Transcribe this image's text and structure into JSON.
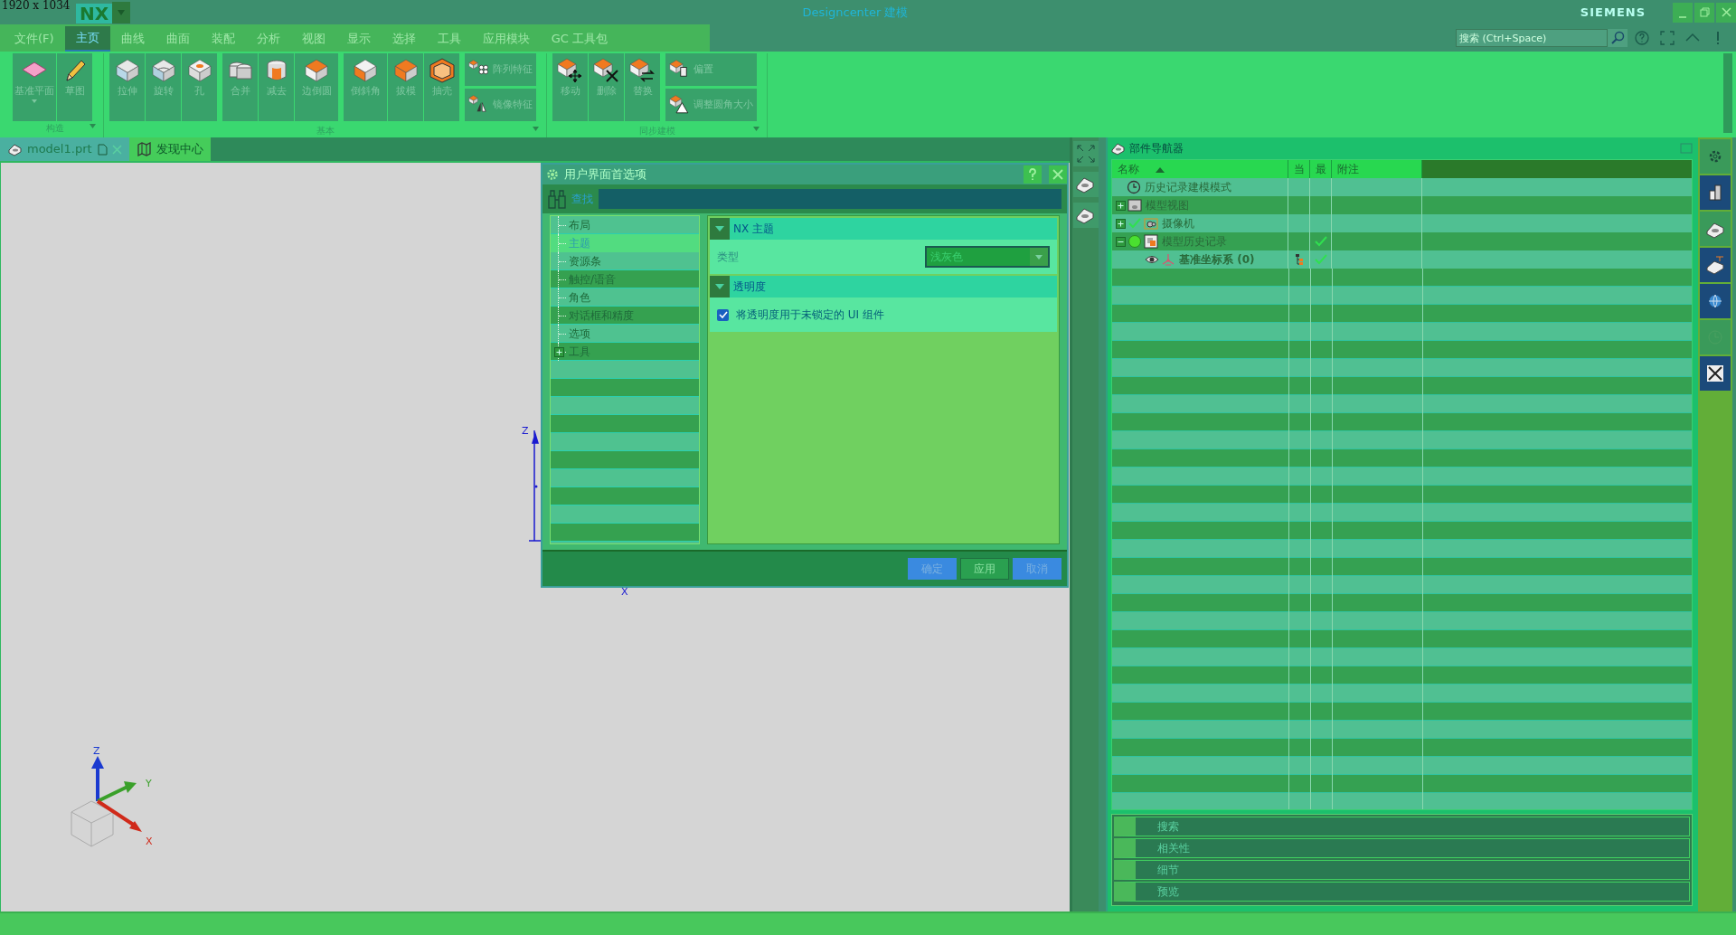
{
  "screen_label": "1920 x 1034",
  "app": {
    "logo": "NX",
    "title": "Designcenter",
    "mode": "建模",
    "brand": "SIEMENS"
  },
  "menu_tabs": [
    {
      "label": "文件(F)",
      "selected": false
    },
    {
      "label": "主页",
      "selected": true
    },
    {
      "label": "曲线",
      "selected": false
    },
    {
      "label": "曲面",
      "selected": false
    },
    {
      "label": "装配",
      "selected": false
    },
    {
      "label": "分析",
      "selected": false
    },
    {
      "label": "视图",
      "selected": false
    },
    {
      "label": "显示",
      "selected": false
    },
    {
      "label": "选择",
      "selected": false
    },
    {
      "label": "工具",
      "selected": false
    },
    {
      "label": "应用模块",
      "selected": false
    },
    {
      "label": "GC 工具包",
      "selected": false
    }
  ],
  "search": {
    "placeholder": "搜索 (Ctrl+Space)"
  },
  "ribbon": [
    {
      "label": "构造",
      "clusters": [
        [
          {
            "label": "基准平面",
            "kind": "large",
            "dropdown": true
          },
          {
            "label": "草图",
            "kind": "large",
            "dropdown": false
          }
        ]
      ]
    },
    {
      "label": "基本",
      "clusters": [
        [
          {
            "label": "拉伸",
            "kind": "large",
            "dropdown": false
          },
          {
            "label": "旋转",
            "kind": "large",
            "dropdown": false
          },
          {
            "label": "孔",
            "kind": "large",
            "dropdown": false
          }
        ],
        [
          {
            "label": "合并",
            "kind": "large",
            "dropdown": false
          },
          {
            "label": "减去",
            "kind": "large",
            "dropdown": false
          },
          {
            "label": "边倒圆",
            "kind": "large",
            "dropdown": false
          }
        ],
        [
          {
            "label": "倒斜角",
            "kind": "large",
            "dropdown": false
          },
          {
            "label": "拔模",
            "kind": "large",
            "dropdown": false
          },
          {
            "label": "抽壳",
            "kind": "large",
            "dropdown": false
          }
        ],
        [
          {
            "label": "阵列特征",
            "kind": "small",
            "dropdown": false
          },
          {
            "label": "镜像特征",
            "kind": "small",
            "dropdown": false
          }
        ]
      ]
    },
    {
      "label": "同步建模",
      "clusters": [
        [
          {
            "label": "移动",
            "kind": "large",
            "dropdown": false
          },
          {
            "label": "删除",
            "kind": "large",
            "dropdown": false
          },
          {
            "label": "替换",
            "kind": "large",
            "dropdown": false
          }
        ],
        [
          {
            "label": "偏置",
            "kind": "small",
            "dropdown": false
          },
          {
            "label": "调整圆角大小",
            "kind": "small",
            "dropdown": false
          }
        ]
      ]
    }
  ],
  "doc_tabs": [
    {
      "label": "model1.prt",
      "selected": true,
      "kind": "part"
    },
    {
      "label": "发现中心",
      "selected": false,
      "kind": "discover"
    }
  ],
  "viewport": {
    "triad_labels": [
      "Z",
      "Y",
      "X"
    ],
    "datum_labels": [
      "Z",
      "X"
    ]
  },
  "dialog": {
    "title": "用户界面首选项",
    "find_label": "查找",
    "tree": [
      {
        "label": "布局",
        "selected": false
      },
      {
        "label": "主题",
        "selected": true
      },
      {
        "label": "资源条",
        "selected": false
      },
      {
        "label": "触控/语音",
        "selected": false
      },
      {
        "label": "角色",
        "selected": false
      },
      {
        "label": "对话框和精度",
        "selected": false
      },
      {
        "label": "选项",
        "selected": false
      },
      {
        "label": "工具",
        "selected": false,
        "expanded": false
      }
    ],
    "sections": [
      {
        "title": "NX 主题",
        "expanded": true,
        "rows": [
          {
            "kind": "dropdown",
            "label": "类型",
            "value": "浅灰色"
          }
        ]
      },
      {
        "title": "透明度",
        "expanded": true,
        "rows": [
          {
            "kind": "checkbox",
            "label": "将透明度用于未锁定的 UI 组件",
            "checked": true
          }
        ]
      }
    ],
    "buttons": [
      {
        "label": "确定",
        "kind": "primary"
      },
      {
        "label": "应用",
        "kind": "default"
      },
      {
        "label": "取消",
        "kind": "primary"
      }
    ]
  },
  "navigator": {
    "title": "部件导航器",
    "columns": [
      "名称",
      "当",
      "最",
      "附注"
    ],
    "rows": [
      {
        "label": "历史记录建模模式",
        "checked": false,
        "active": false,
        "visible": false,
        "current": false,
        "latest": false
      },
      {
        "label": "模型视图",
        "checked": false,
        "active": false,
        "visible": false,
        "current": false,
        "latest": false,
        "expanded": false
      },
      {
        "label": "摄像机",
        "checked": true,
        "active": false,
        "visible": false,
        "current": false,
        "latest": false,
        "expanded": false
      },
      {
        "label": "模型历史记录",
        "checked": false,
        "active": true,
        "visible": false,
        "current": false,
        "latest": true,
        "expanded": true,
        "children": [
          {
            "label": "基准坐标系 (0)",
            "checked": false,
            "active": false,
            "visible": true,
            "current": true,
            "latest": true
          }
        ]
      }
    ],
    "panels": [
      {
        "label": "搜索",
        "expanded": false
      },
      {
        "label": "相关性",
        "expanded": false
      },
      {
        "label": "细节",
        "expanded": false
      },
      {
        "label": "预览",
        "expanded": false
      }
    ]
  }
}
